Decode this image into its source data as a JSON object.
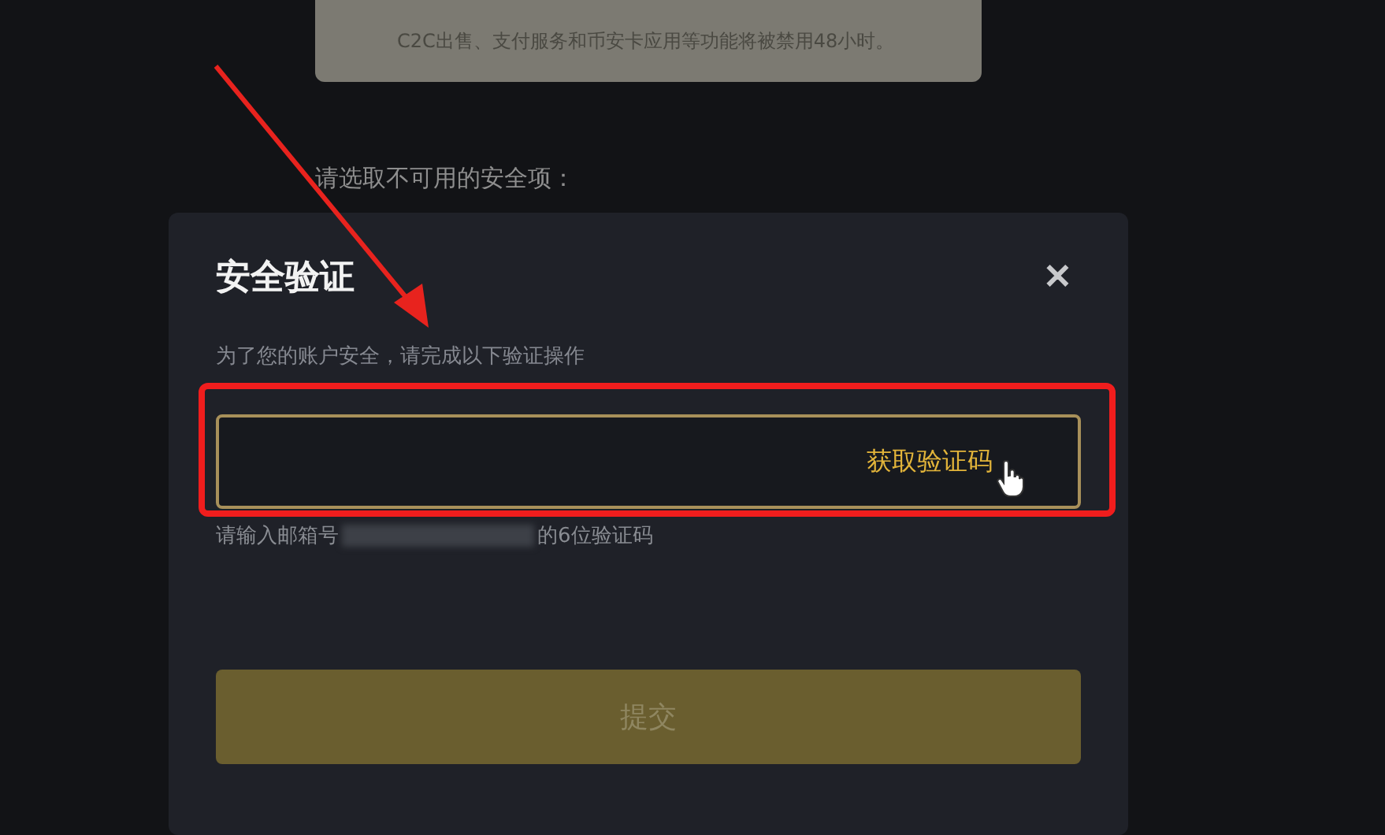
{
  "background_notice": {
    "text": "C2C出售、支付服务和币安卡应用等功能将被禁用48小时。"
  },
  "background_prompt": "请选取不可用的安全项：",
  "dialog": {
    "title": "安全验证",
    "close": "✕",
    "subtitle": "为了您的账户安全，请完成以下验证操作",
    "code_field": {
      "action": "获取验证码"
    },
    "hint": {
      "before": "请输入邮箱号",
      "after": "的6位验证码"
    },
    "submit": {
      "label": "提交",
      "disabled": true
    }
  },
  "annotation": {
    "highlight_box": true,
    "arrow": true
  }
}
